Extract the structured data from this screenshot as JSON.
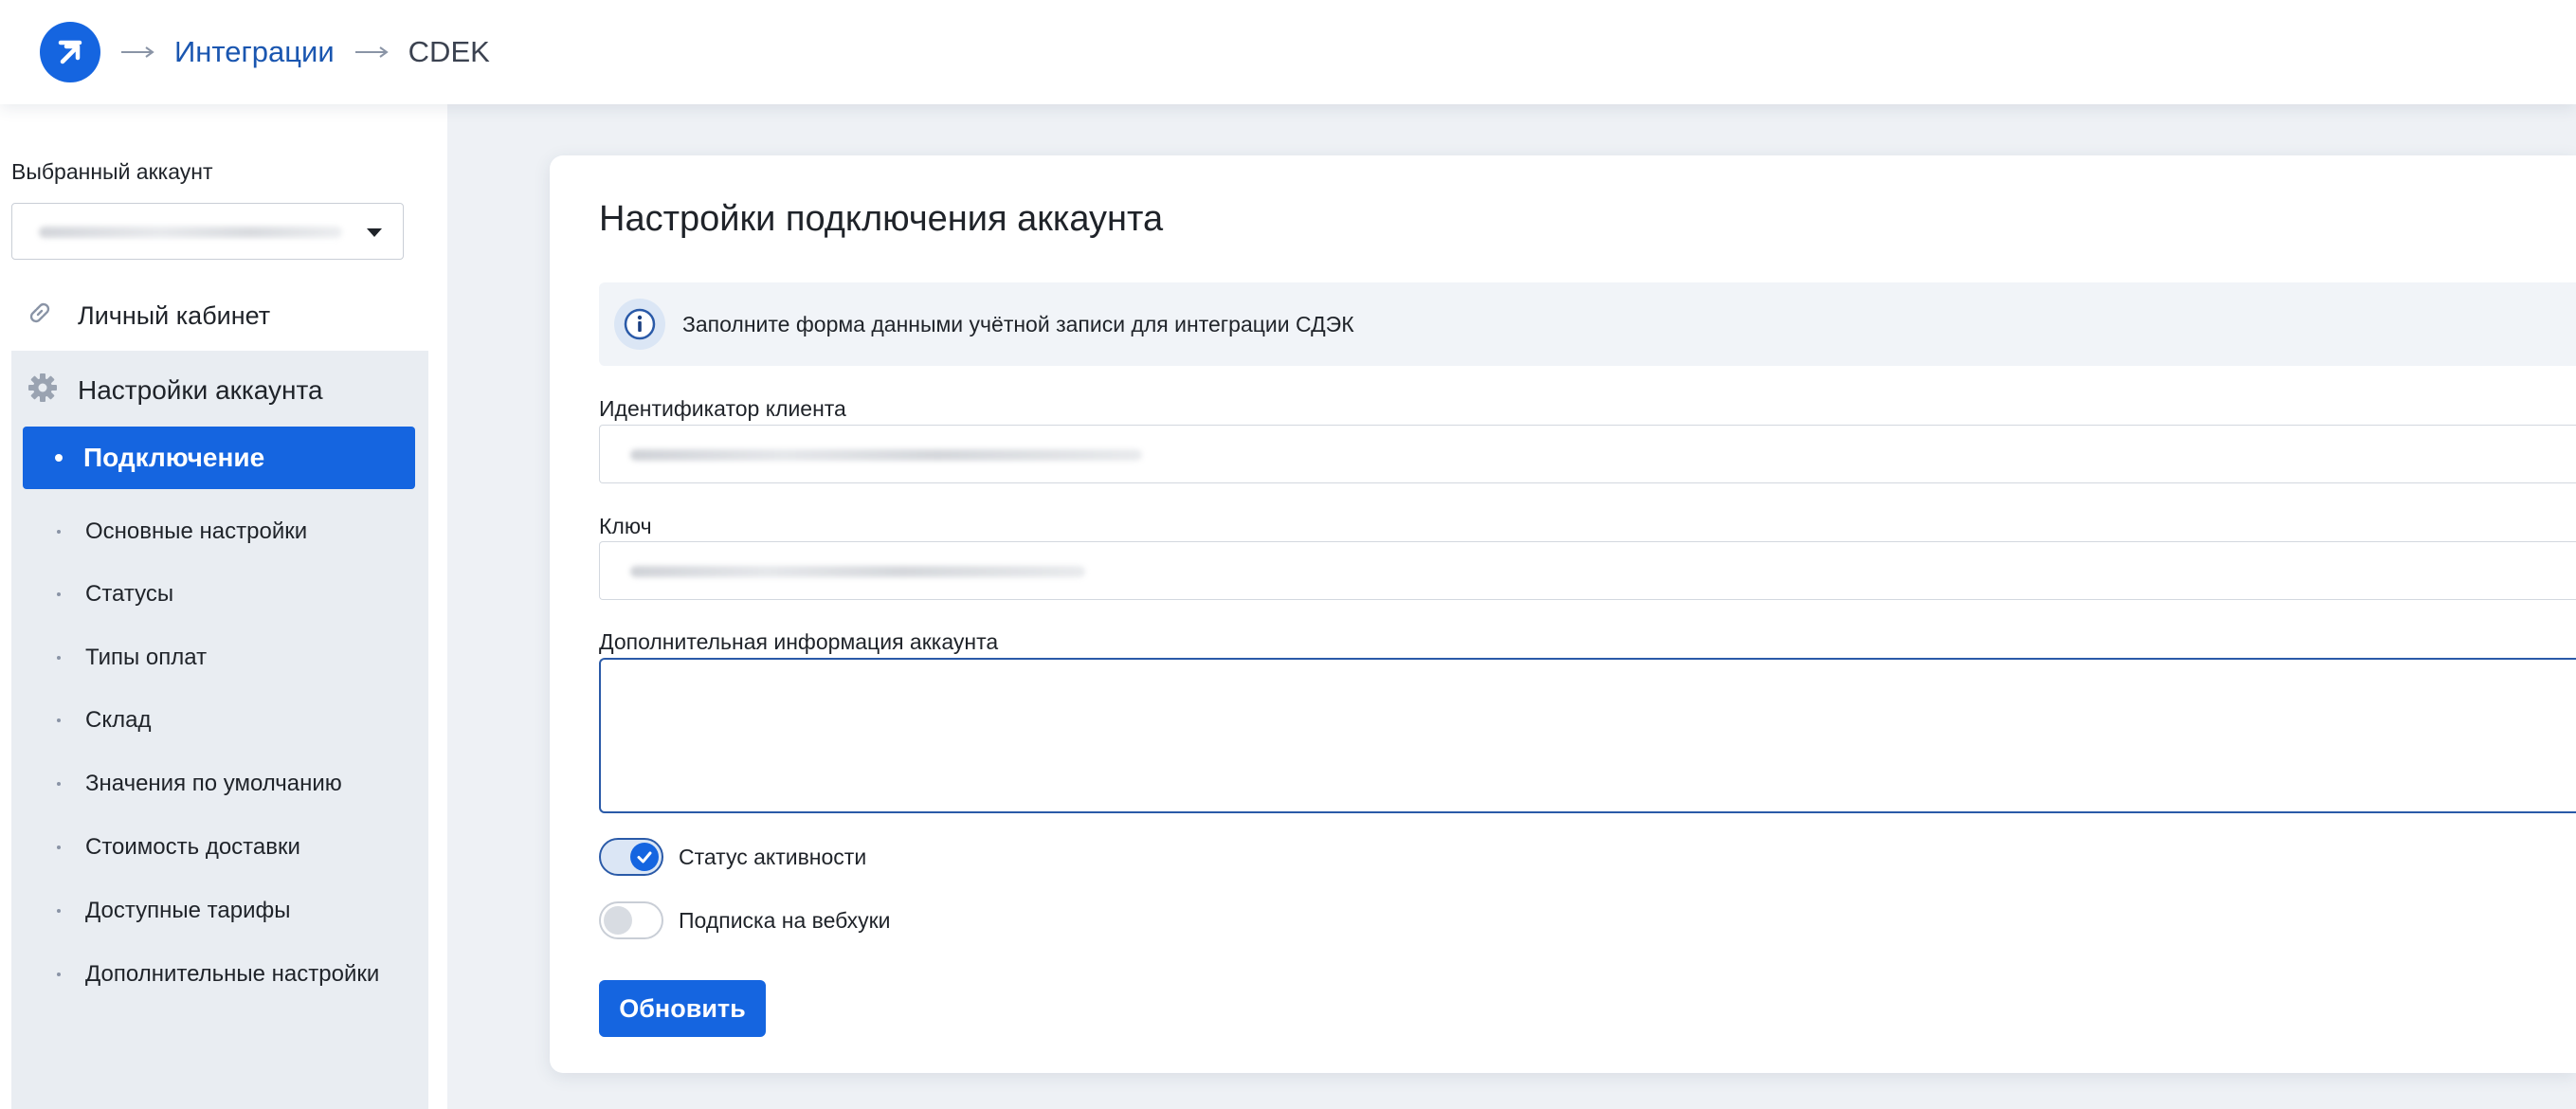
{
  "header": {
    "logo_icon": "app-logo-arrow",
    "breadcrumbs": [
      {
        "label": "Интеграции",
        "link": true
      },
      {
        "label": "CDEK",
        "link": false
      }
    ]
  },
  "sidebar": {
    "account_label": "Выбранный аккаунт",
    "account_value_blurred": true,
    "cabinet_link": "Личный кабинет",
    "settings_section": "Настройки аккаунта",
    "active_item": "Подключение",
    "items": [
      "Основные настройки",
      "Статусы",
      "Типы оплат",
      "Склад",
      "Значения по умолчанию",
      "Стоимость доставки",
      "Доступные тарифы",
      "Дополнительные настройки"
    ]
  },
  "card": {
    "title": "Настройки подключения аккаунта",
    "info_text": "Заполните форма данными учётной записи для интеграции СДЭК",
    "client_id_label": "Идентификатор клиента",
    "key_label": "Ключ",
    "extra_info_label": "Дополнительная информация аккаунта",
    "extra_info_value": "",
    "active_status_label": "Статус активности",
    "active_status_on": true,
    "webhook_label": "Подписка на вебхуки",
    "webhook_on": false,
    "update_button": "Обновить"
  },
  "colors": {
    "accent": "#1565e0",
    "link": "#1a56b0",
    "panel_bg": "#e9edf2",
    "main_bg": "#eef1f5"
  }
}
